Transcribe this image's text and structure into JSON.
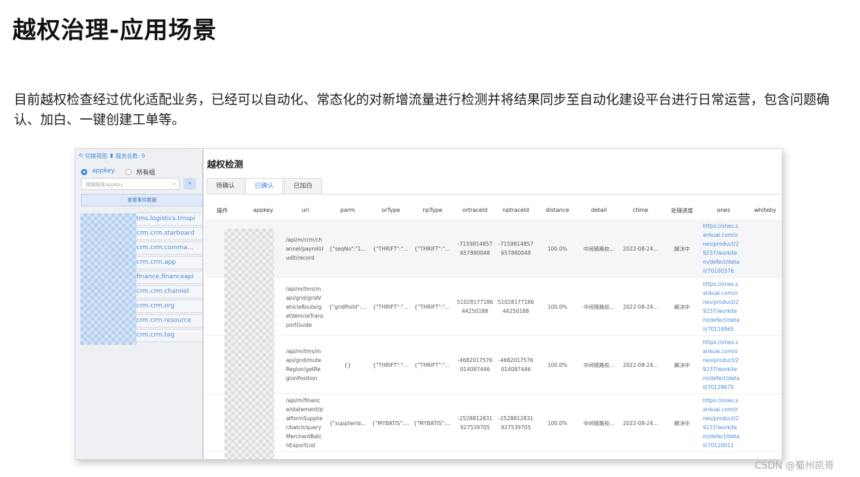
{
  "slide": {
    "title": "越权治理-应用场景",
    "description": "目前越权检查经过优化适配业务，已经可以自动化、常态化的对新增流量进行检测并将结果同步至自动化建设平台进行日常运营，包含问题确认、加白、一键创建工单等。"
  },
  "left_panel": {
    "switch_view_label": "切换视图",
    "service_total_label": "服务总数: 9",
    "radio_appkey": "appkey",
    "radio_all_groups": "所有组",
    "search_placeholder": "模糊搜索appKey",
    "search_go": "»",
    "query_button": "查看事件数据",
    "services": [
      "tms.logistics.tmspi",
      "crm.crm.starboard",
      "crm.crm.comma...",
      "crm.crm.app",
      "finance.financeapi",
      "crm.crm.channel",
      "crm.crm.org",
      "crm.crm.resource",
      "crm.crm.tag"
    ]
  },
  "right_panel": {
    "title": "越权检测",
    "tabs": [
      "待确认",
      "已确认",
      "已加白"
    ],
    "active_tab": 1,
    "columns": [
      "操作",
      "appkey",
      "uri",
      "parm",
      "orType",
      "npType",
      "ortraceId",
      "nptraceId",
      "distance",
      "detail",
      "ctime",
      "处理进度",
      "ones",
      "whiteby"
    ],
    "rows": [
      {
        "uri": [
          "/api/m/crm/ch",
          "annel/payroll/A",
          "udit/record"
        ],
        "parm": "{\"seqNo\":\"1...",
        "orType": "{\"THRIFT\":\"...",
        "npType": "{\"THRIFT\":\"...",
        "ortraceId": [
          "-7159814857",
          "657880048"
        ],
        "nptraceId": [
          "-7159814857",
          "657880048"
        ],
        "distance": "100.0%",
        "detail": "中间链路校...",
        "ctime": "2022-08-24...",
        "status": "解决中",
        "ones": [
          "https://ones.s",
          "ankuai.com/o",
          "nes/product/2",
          "9237/workite",
          "m/defect/deta",
          "il/70100376"
        ]
      },
      {
        "uri": [
          "/api/m/tms/m",
          "api/grid/gridV",
          "ehicleRoute/g",
          "etVehicleTrans",
          "portGuide"
        ],
        "parm": "{\"gridPoiId\":...",
        "orType": "{\"THRIFT\":\"...",
        "npType": "{\"THRIFT\":\"...",
        "ortraceId": [
          "51028177186",
          "44250188"
        ],
        "nptraceId": [
          "51028177186",
          "44250188"
        ],
        "distance": "100.0%",
        "detail": "中间链路校...",
        "ctime": "2022-08-24...",
        "status": "解决中",
        "ones": [
          "https://ones.s",
          "ankuai.com/o",
          "nes/product/2",
          "9237/workite",
          "m/defect/deta",
          "il/70119965"
        ]
      },
      {
        "uri": [
          "/api/m/tms/m",
          "api/grid/mute",
          "Region/getRe",
          "gionPosition"
        ],
        "parm": "{}",
        "orType": "{\"THRIFT\":\"...",
        "npType": "{\"THRIFT\":\"...",
        "ortraceId": [
          "-4682017576",
          "014087446"
        ],
        "nptraceId": [
          "-4682017576",
          "014087446"
        ],
        "distance": "100.0%",
        "detail": "中间链路校...",
        "ctime": "2022-08-24...",
        "status": "解决中",
        "ones": [
          "https://ones.s",
          "ankuai.com/o",
          "nes/product/2",
          "9237/workite",
          "m/defect/deta",
          "il/70128675"
        ]
      },
      {
        "uri": [
          "/api/m/financ",
          "e/statement/pl",
          "atformSupplie",
          "r/batch/query",
          "MerchantBatc",
          "hExportList"
        ],
        "parm": "{\"supplierId...",
        "orType": "{\"MYBATIS\":...",
        "npType": "{\"MYBATIS\":...",
        "ortraceId": [
          "-2528812831",
          "927539705"
        ],
        "nptraceId": [
          "-2528812831",
          "927539705"
        ],
        "distance": "100.0%",
        "detail": "中间链路校...",
        "ctime": "2022-08-24...",
        "status": "解决中",
        "ones": [
          "https://ones.s",
          "ankuai.com/o",
          "nes/product/2",
          "9237/workite",
          "m/defect/deta",
          "il/70120011"
        ]
      }
    ]
  },
  "footer": {
    "credit": "CSDN @蜀州凯哥"
  }
}
